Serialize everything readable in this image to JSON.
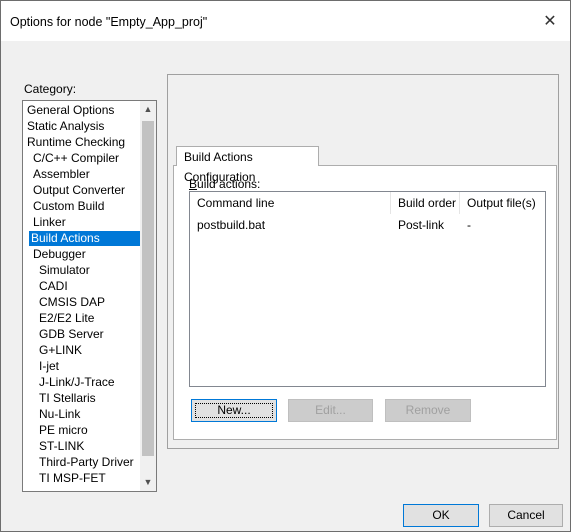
{
  "window": {
    "title": "Options for node \"Empty_App_proj\"",
    "close_glyph": "✕"
  },
  "category": {
    "label": "Category:",
    "items": [
      {
        "label": "General Options",
        "level": 0
      },
      {
        "label": "Static Analysis",
        "level": 0
      },
      {
        "label": "Runtime Checking",
        "level": 0
      },
      {
        "label": "C/C++ Compiler",
        "level": 1
      },
      {
        "label": "Assembler",
        "level": 1
      },
      {
        "label": "Output Converter",
        "level": 1
      },
      {
        "label": "Custom Build",
        "level": 1
      },
      {
        "label": "Linker",
        "level": 1
      },
      {
        "label": "Build Actions",
        "level": 1,
        "selected": true
      },
      {
        "label": "Debugger",
        "level": 1
      },
      {
        "label": "Simulator",
        "level": 2
      },
      {
        "label": "CADI",
        "level": 2
      },
      {
        "label": "CMSIS DAP",
        "level": 2
      },
      {
        "label": "E2/E2 Lite",
        "level": 2
      },
      {
        "label": "GDB Server",
        "level": 2
      },
      {
        "label": "G+LINK",
        "level": 2
      },
      {
        "label": "I-jet",
        "level": 2
      },
      {
        "label": "J-Link/J-Trace",
        "level": 2
      },
      {
        "label": "TI Stellaris",
        "level": 2
      },
      {
        "label": "Nu-Link",
        "level": 2
      },
      {
        "label": "PE micro",
        "level": 2
      },
      {
        "label": "ST-LINK",
        "level": 2
      },
      {
        "label": "Third-Party Driver",
        "level": 2
      },
      {
        "label": "TI MSP-FET",
        "level": 2
      }
    ]
  },
  "tab": {
    "label": "Build Actions Configuration"
  },
  "build_actions": {
    "label_first": "B",
    "label_rest": "uild actions:",
    "columns": [
      "Command line",
      "Build order",
      "Output file(s)"
    ],
    "rows": [
      [
        "postbuild.bat",
        "Post-link",
        "-"
      ]
    ]
  },
  "buttons": {
    "new": "New...",
    "edit": "Edit...",
    "remove": "Remove",
    "ok": "OK",
    "cancel": "Cancel"
  },
  "colors": {
    "selection": "#0078d7",
    "accent_border": "#0078d7"
  },
  "icons": {
    "scroll_up": "▲",
    "scroll_down": "▼"
  }
}
